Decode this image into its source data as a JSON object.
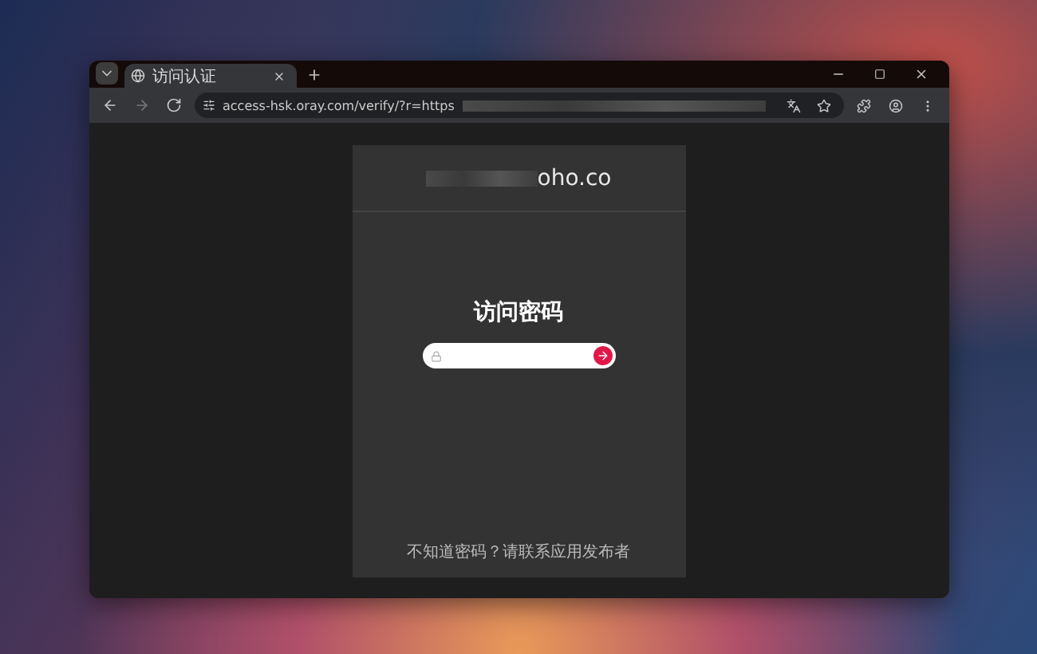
{
  "tabs": [
    {
      "title": "访问认证",
      "selected": true
    }
  ],
  "address_bar": {
    "url": "access-hsk.oray.com/verify/?r=https"
  },
  "card": {
    "site": "oho.co",
    "title": "访问密码",
    "footer": "不知道密码？请联系应用发布者"
  }
}
